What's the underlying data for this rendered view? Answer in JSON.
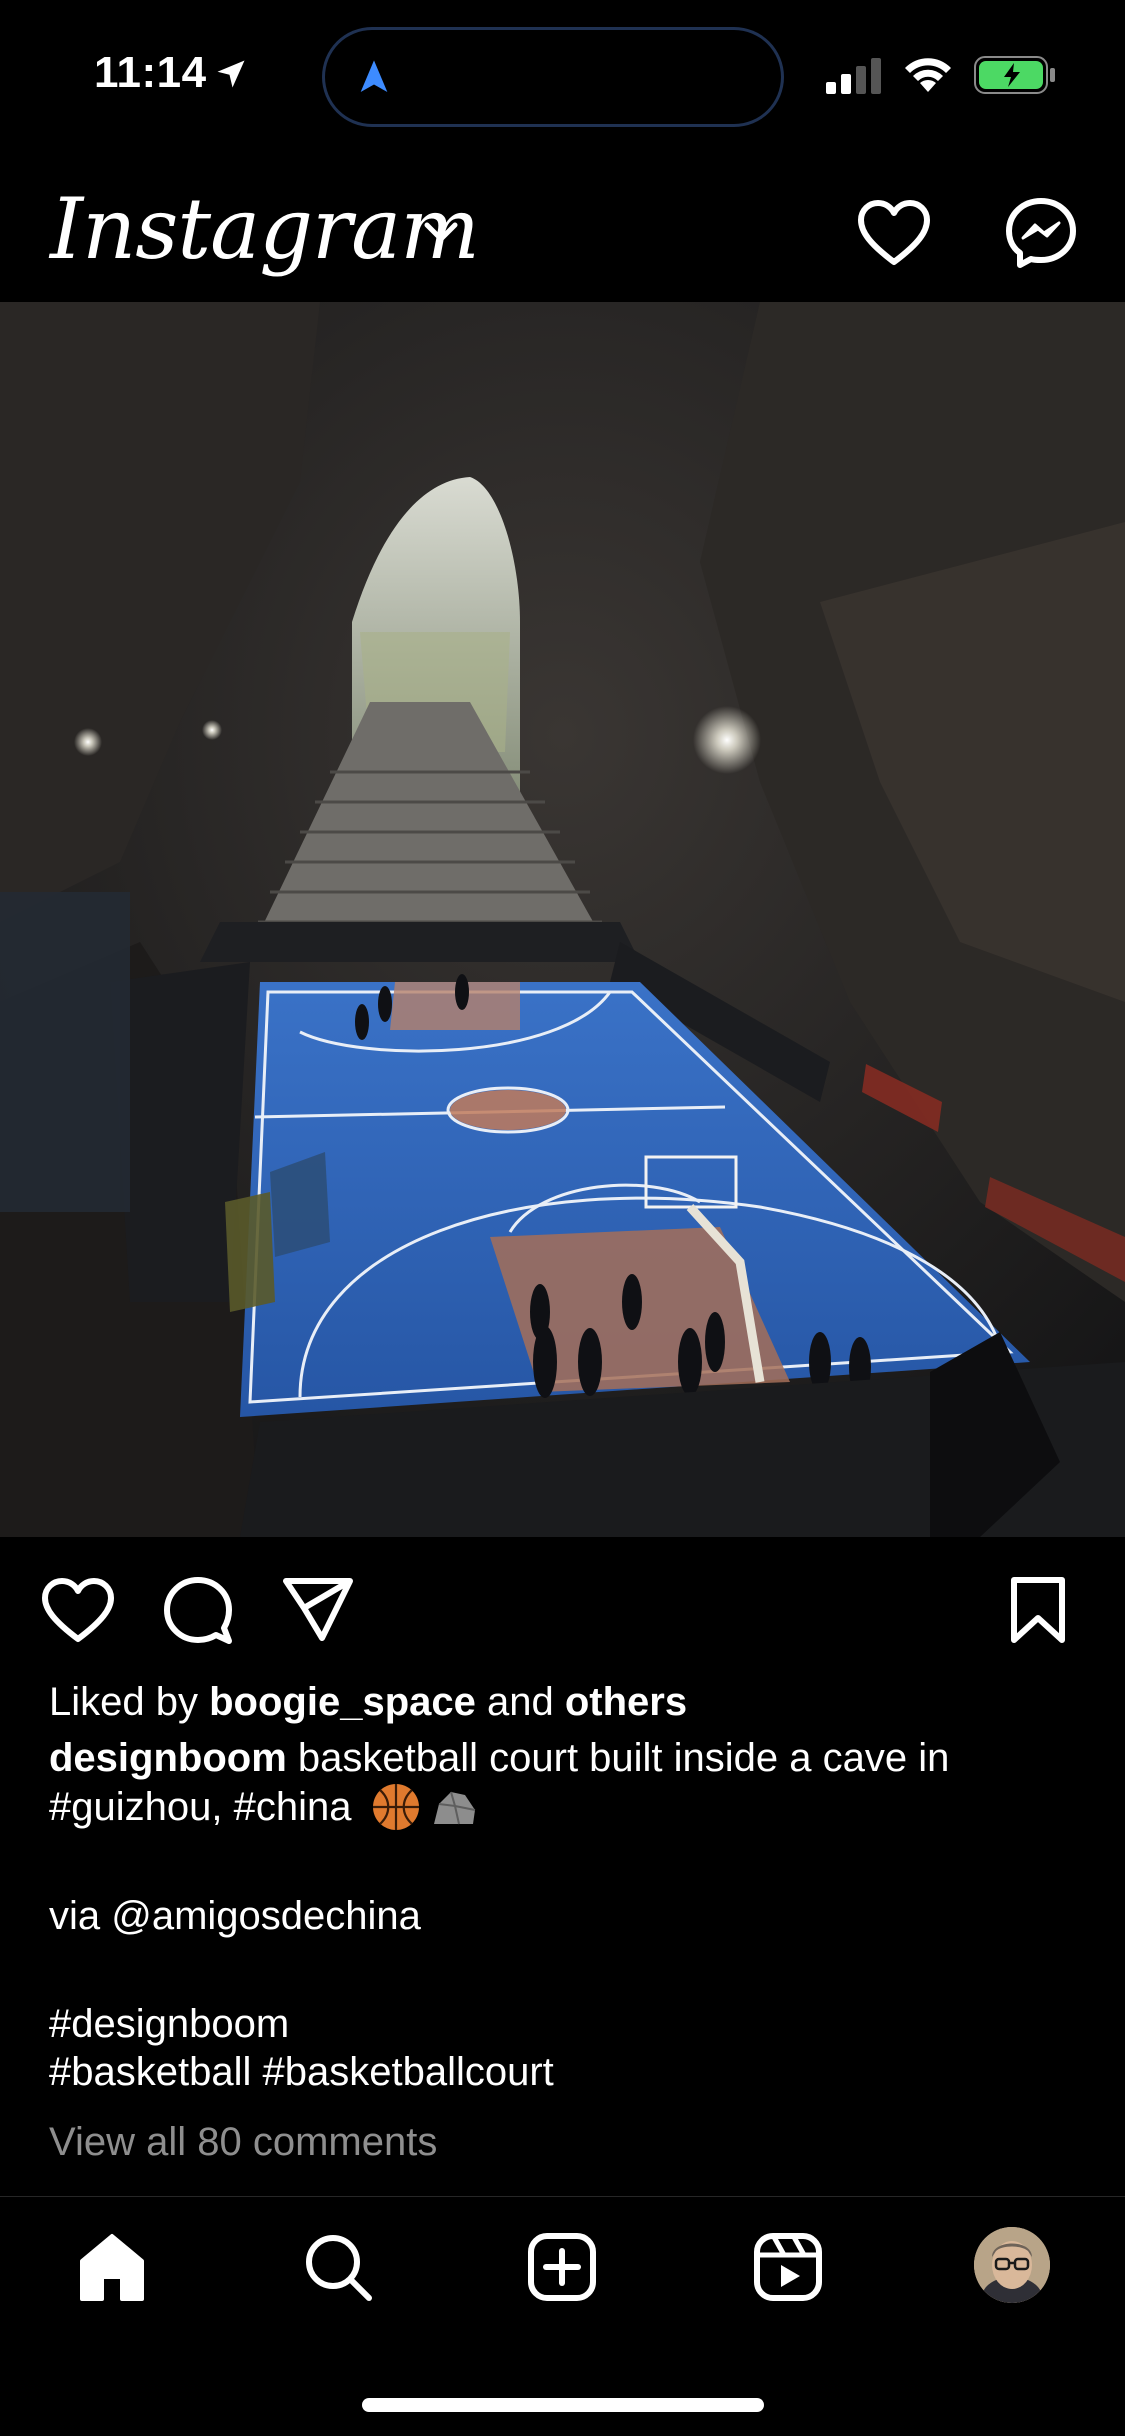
{
  "status_bar": {
    "time": "11:14",
    "icons": [
      "location-arrow-icon",
      "navigation-icon",
      "signal-icon",
      "wifi-icon",
      "battery-charging-icon"
    ]
  },
  "header": {
    "app_name": "Instagram",
    "icons": [
      "chevron-down-icon",
      "heart-icon",
      "messenger-icon"
    ]
  },
  "post": {
    "liked_by_prefix": "Liked by ",
    "liked_by_user": "boogie_space",
    "liked_by_and": " and ",
    "liked_by_others": "others",
    "author": "designboom",
    "caption_line1": " basketball court built inside a cave in",
    "caption_line2": "#guizhou, #china",
    "caption_emojis": [
      "basketball-emoji",
      "rock-emoji"
    ],
    "via_line": "via @amigosdechina",
    "tag_line1": "#designboom",
    "tag_line2": "#basketball #basketballcourt",
    "view_comments": "View all 80 comments"
  },
  "actions": [
    "like-icon",
    "comment-icon",
    "share-icon",
    "save-icon"
  ],
  "bottom_nav": [
    "home-icon",
    "search-icon",
    "new-post-icon",
    "reels-icon",
    "profile-avatar"
  ],
  "colors": {
    "background": "#000000",
    "muted_text": "#8e8e8e",
    "court_blue": "#2f62b8",
    "battery_green": "#4cd964",
    "island_outline": "#1f3152"
  }
}
